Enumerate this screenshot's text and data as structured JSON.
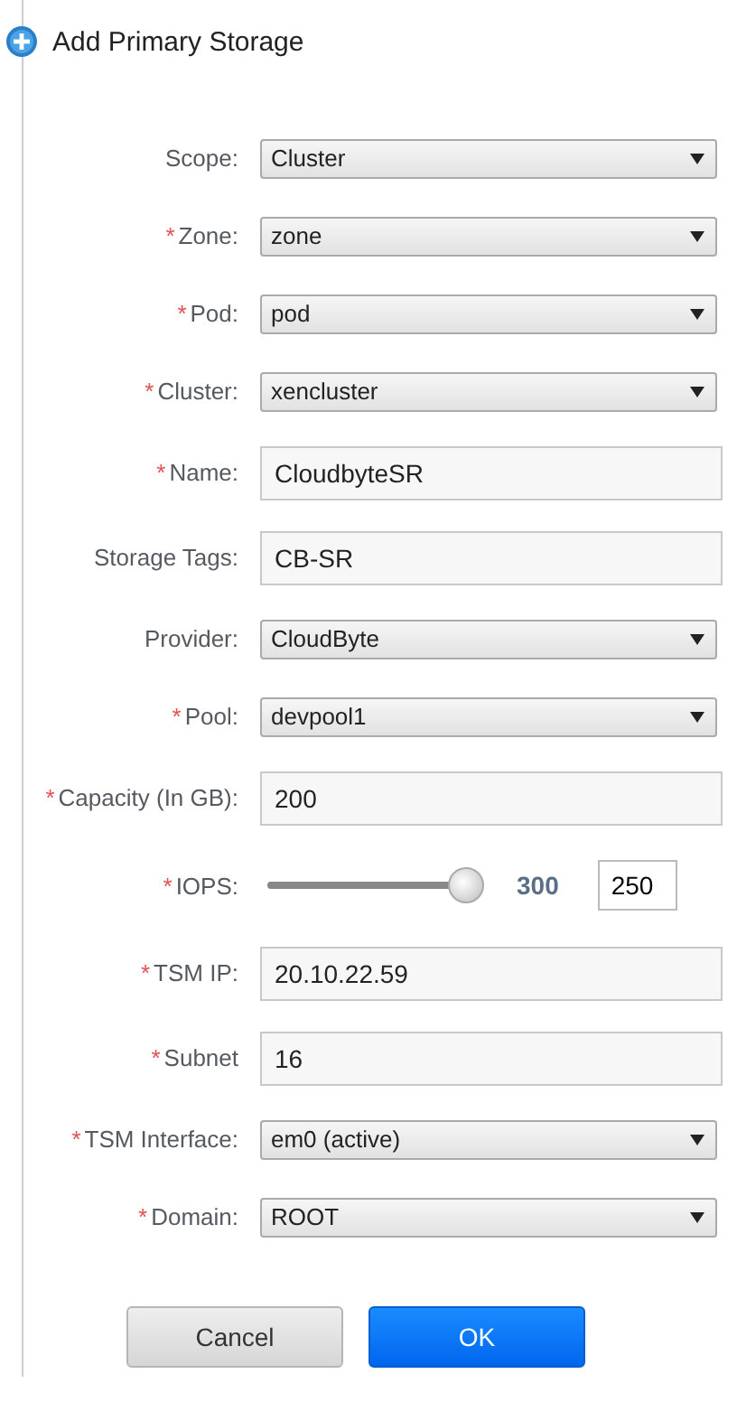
{
  "title": "Add Primary Storage",
  "fields": [
    {
      "kind": "select",
      "label": "Scope:",
      "value": "Cluster"
    },
    {
      "kind": "select",
      "label": "Zone:",
      "asterisk": "*",
      "value": "zone"
    },
    {
      "kind": "select",
      "label": "Pod:",
      "asterisk": "*",
      "value": "pod"
    },
    {
      "kind": "select",
      "label": "Cluster:",
      "asterisk": "*",
      "value": "xencluster"
    },
    {
      "kind": "text",
      "label": "Name:",
      "asterisk": "*",
      "value": "CloudbyteSR"
    },
    {
      "kind": "text",
      "label": "Storage Tags:",
      "value": "CB-SR"
    },
    {
      "kind": "select",
      "label": "Provider:",
      "value": "CloudByte"
    },
    {
      "kind": "select",
      "label": "Pool:",
      "asterisk": "*",
      "value": "devpool1"
    },
    {
      "kind": "text",
      "label": "Capacity (In GB):",
      "asterisk": "*",
      "value": "200"
    },
    {
      "kind": "slider",
      "label": "IOPS:",
      "asterisk": "*",
      "level": 1,
      "reading": "300",
      "value": "250"
    },
    {
      "kind": "text",
      "label": "TSM IP:",
      "asterisk": "*",
      "value": "20.10.22.59"
    },
    {
      "kind": "text",
      "label": "Subnet",
      "asterisk": "*",
      "value": "16"
    },
    {
      "kind": "select",
      "label": "TSM Interface:",
      "asterisk": "*",
      "value": "em0 (active)"
    },
    {
      "kind": "select",
      "label": "Domain:",
      "asterisk": "*",
      "value": "ROOT"
    }
  ],
  "buttons": [
    {
      "label": "Cancel",
      "primary": false
    },
    {
      "label": "OK",
      "primary": true
    }
  ]
}
